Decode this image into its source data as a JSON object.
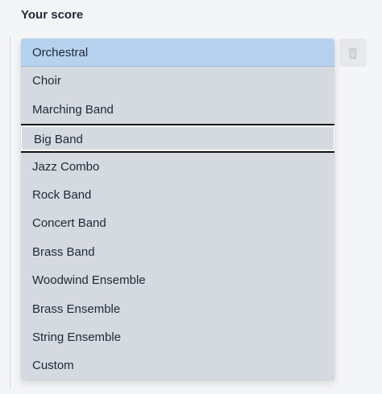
{
  "section": {
    "title": "Your score"
  },
  "dropdown": {
    "selected_value": "Orchestral",
    "focused_value": "Big Band",
    "options": [
      "Orchestral",
      "Choir",
      "Marching Band",
      "Big Band",
      "Jazz Combo",
      "Rock Band",
      "Concert Band",
      "Brass Band",
      "Woodwind Ensemble",
      "Brass Ensemble",
      "String Ensemble",
      "Custom"
    ]
  },
  "actions": {
    "delete_icon": "trash-icon"
  },
  "colors": {
    "selected_bg": "#b7d2ef",
    "menu_bg": "#d5d9e0",
    "text": "#1f2937",
    "focus_border": "#111111"
  }
}
